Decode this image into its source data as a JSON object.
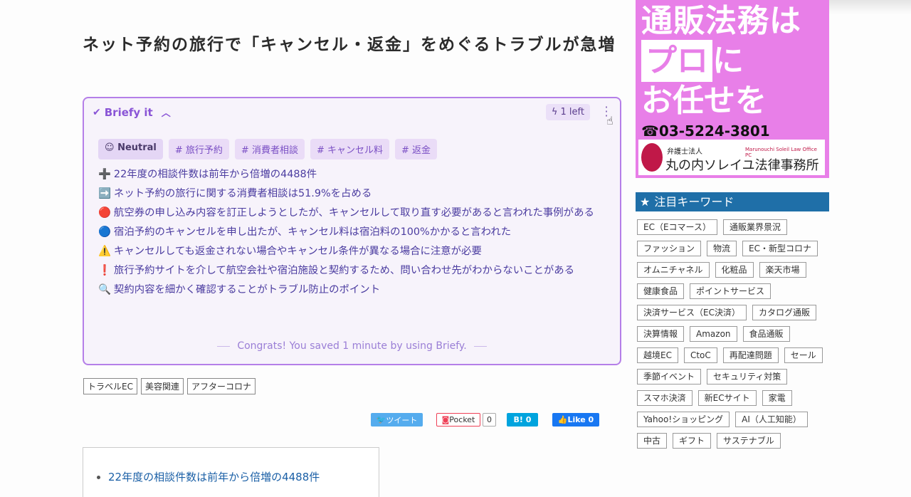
{
  "article": {
    "title": "ネット予約の旅行で「キャンセル・返金」をめぐるトラブルが急増"
  },
  "briefy": {
    "brand": "Briefy it",
    "credits": "1 left",
    "tags": [
      "Neutral",
      "# 旅行予約",
      "# 消費者相談",
      "# キャンセル料",
      "# 返金"
    ],
    "points": [
      {
        "icon": "➕",
        "text": "22年度の相談件数は前年から倍増の4488件"
      },
      {
        "icon": "➡️",
        "text": "ネット予約の旅行に関する消費者相談は51.9%を占める"
      },
      {
        "icon": "🔴",
        "text": "航空券の申し込み内容を訂正しようとしたが、キャンセルして取り直す必要があると言われた事例がある"
      },
      {
        "icon": "🔵",
        "text": "宿泊予約のキャンセルを申し出たが、キャンセル料は宿泊料の100%かかると言われた"
      },
      {
        "icon": "⚠️",
        "text": "キャンセルしても返金されない場合やキャンセル条件が異なる場合に注意が必要"
      },
      {
        "icon": "❗",
        "text": "旅行予約サイトを介して航空会社や宿泊施設と契約するため、問い合わせ先がわからないことがある"
      },
      {
        "icon": "🔍",
        "text": "契約内容を細かく確認することがトラブル防止のポイント"
      }
    ],
    "congrats": "Congrats! You saved 1 minute by using Briefy."
  },
  "article_tags": [
    "トラベルEC",
    "美容関連",
    "アフターコロナ"
  ],
  "share": {
    "tweet": "ツイート",
    "pocket": "Pocket",
    "pocket_count": "0",
    "hatena": "B! 0",
    "fb_like": "Like 0"
  },
  "toc": {
    "first_item": "22年度の相談件数は前年から倍増の4488件"
  },
  "ad": {
    "line1": "通販法務は",
    "line2_box": "プロ",
    "line2_rest": "に",
    "line3": "お任せを",
    "tel": "☎03-5224-3801",
    "firm_small": "弁護士法人",
    "firm_en": "Marunouchi Soleil Law Office PC",
    "firm_name": "丸の内ソレイユ法律事務所"
  },
  "sidebar": {
    "keywords_title": "注目キーワード",
    "keywords": [
      "EC（Eコマース）",
      "通販業界景況",
      "ファッション",
      "物流",
      "EC・新型コロナ",
      "オムニチャネル",
      "化粧品",
      "楽天市場",
      "健康食品",
      "ポイントサービス",
      "決済サービス（EC決済）",
      "カタログ通販",
      "決算情報",
      "Amazon",
      "食品通販",
      "越境EC",
      "CtoC",
      "再配達問題",
      "セール",
      "季節イベント",
      "セキュリティ対策",
      "スマホ決済",
      "新ECサイト",
      "家電",
      "Yahoo!ショッピング",
      "AI（人工知能）",
      "中古",
      "ギフト",
      "サステナブル"
    ]
  }
}
